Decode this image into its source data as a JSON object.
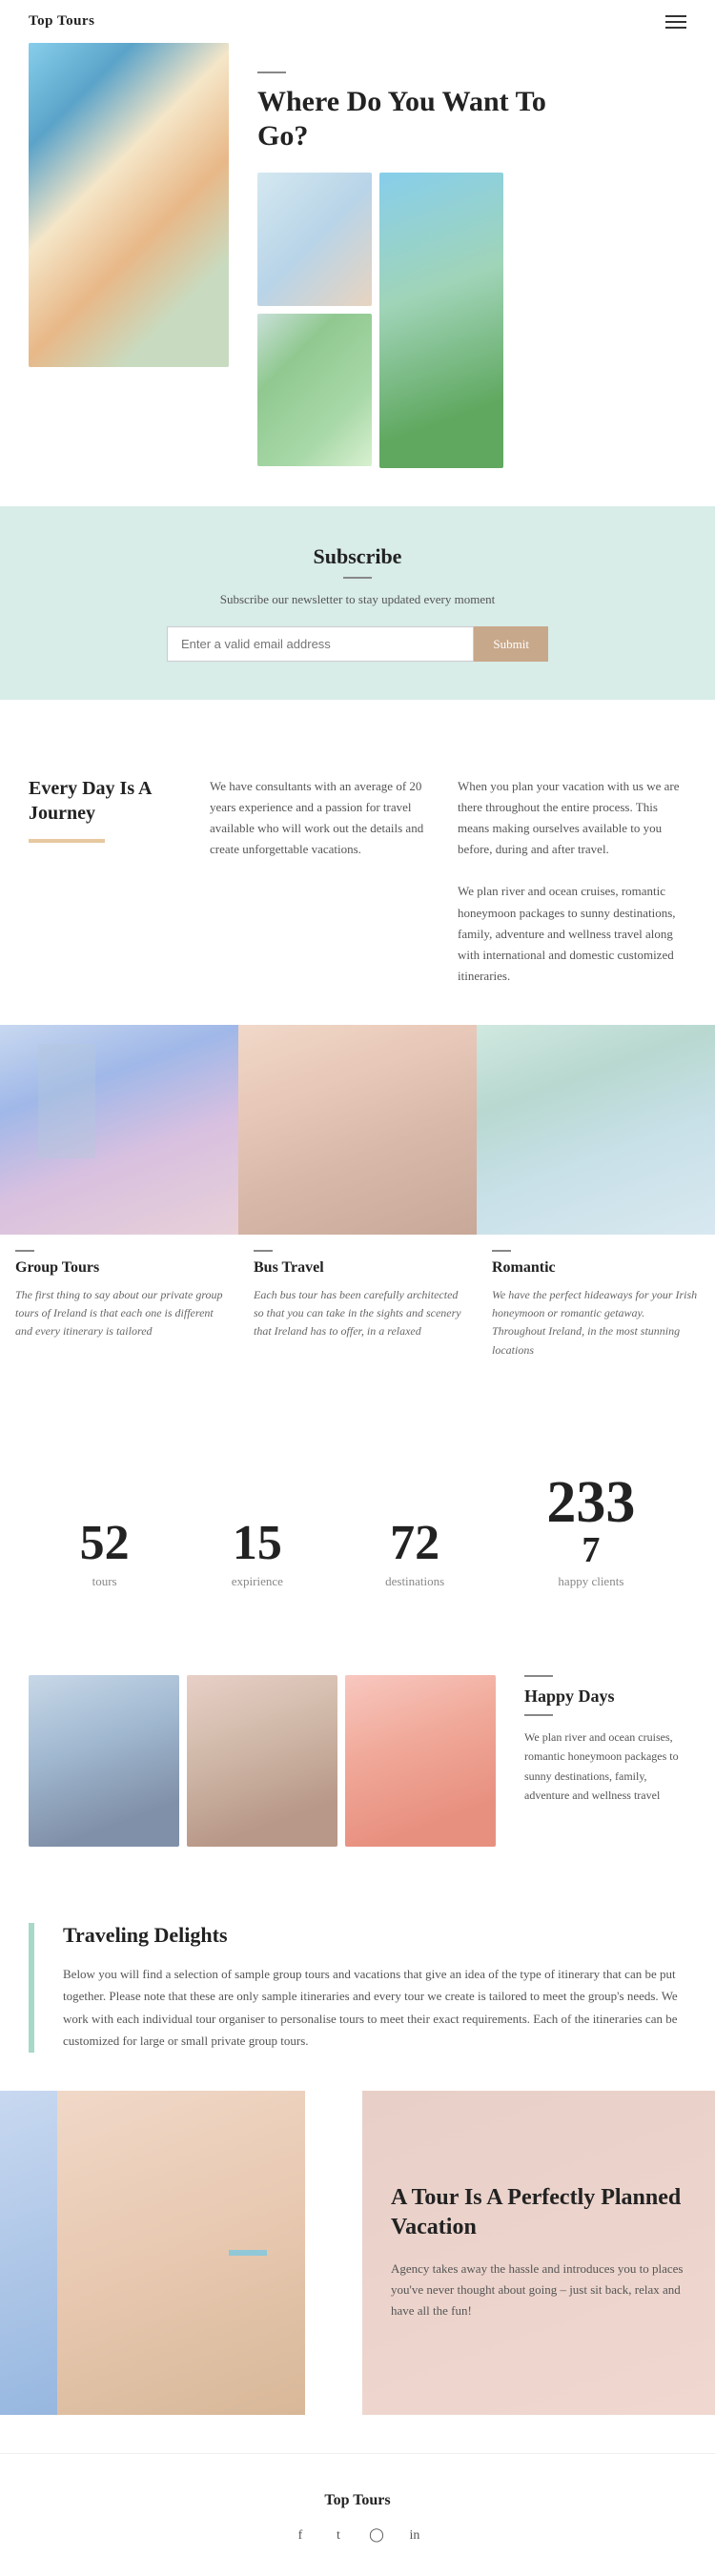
{
  "header": {
    "logo": "Top Tours"
  },
  "hero": {
    "title_line1": "Where Do You Want To",
    "title_line2": "Go?"
  },
  "subscribe": {
    "title": "Subscribe",
    "subtitle": "Subscribe our newsletter to stay updated every moment",
    "input_placeholder": "Enter a valid email address",
    "button_label": "Submit"
  },
  "journey": {
    "title": "Every Day Is A Journey",
    "col1": "We have consultants with an average of 20 years experience and a passion for travel available who will work out the details and create unforgettable vacations.",
    "col2": "When you plan your vacation with us we are there throughout the entire process. This means making ourselves available to you before, during and after travel.\n\nWe plan river and ocean cruises, romantic honeymoon packages to sunny destinations, family, adventure and wellness travel along with international and domestic customized itineraries."
  },
  "tours": [
    {
      "title": "Group Tours",
      "description": "The first thing to say about our private group tours of Ireland is that each one is different and every itinerary is tailored"
    },
    {
      "title": "Bus Travel",
      "description": "Each bus tour has been carefully architected so that you can take in the sights and scenery that Ireland has to offer, in a relaxed"
    },
    {
      "title": "Romantic",
      "description": "We have the perfect hideaways for your Irish honeymoon or romantic getaway. Throughout Ireland, in the most stunning locations"
    }
  ],
  "stats": [
    {
      "number": "52",
      "label": "tours"
    },
    {
      "number": "15",
      "label": "expirience"
    },
    {
      "number": "72",
      "label": "destinations"
    },
    {
      "number1": "2337",
      "label": "happy clients"
    }
  ],
  "happy_days": {
    "title": "Happy Days",
    "text": "We plan river and ocean cruises, romantic honeymoon packages to sunny destinations, family, adventure and wellness travel"
  },
  "delights": {
    "title": "Traveling Delights",
    "text": "Below you will find a selection of sample group tours and vacations that give an idea of the type of itinerary that can be put together. Please note that these are only sample itineraries and every tour we create is tailored to meet the group's needs. We work with each individual tour organiser to personalise tours to meet their exact requirements. Each of the itineraries can be customized for large or small private group tours."
  },
  "vacation": {
    "title": "A Tour Is A Perfectly Planned Vacation",
    "text": "Agency takes away the hassle and introduces you to places you've never thought about going – just sit back, relax and have all the fun!"
  },
  "footer": {
    "logo": "Top Tours",
    "social": [
      "f",
      "t",
      "in_icon",
      "in"
    ]
  }
}
